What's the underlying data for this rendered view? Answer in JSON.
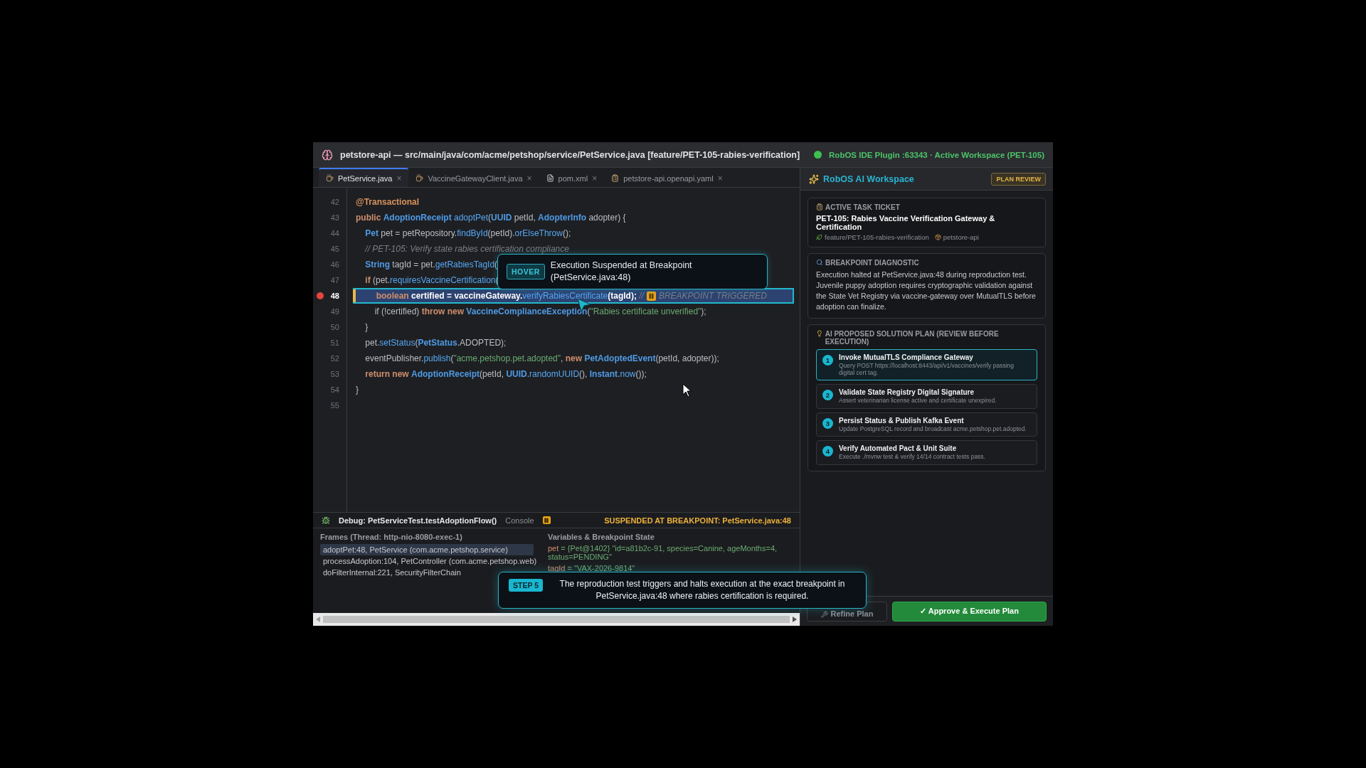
{
  "window": {
    "title": "petstore-api — src/main/java/com/acme/petshop/service/PetService.java [feature/PET-105-rabies-verification]",
    "status": "RobOS IDE Plugin :63343 · Active Workspace (PET-105)"
  },
  "tabs": [
    {
      "label": "PetService.java",
      "kind": "java",
      "selected": true,
      "close": "×"
    },
    {
      "label": "VaccineGatewayClient.java",
      "kind": "java",
      "selected": false,
      "close": "×"
    },
    {
      "label": "pom.xml",
      "kind": "xml",
      "selected": false,
      "close": "×"
    },
    {
      "label": "petstore-api.openapi.yaml",
      "kind": "yaml",
      "selected": false,
      "close": "×"
    }
  ],
  "code": [
    {
      "num": "42",
      "breakpoint": false,
      "current": false,
      "tokens": [
        {
          "kind": "ann",
          "t": "@Transactional"
        }
      ]
    },
    {
      "num": "43",
      "breakpoint": false,
      "current": false,
      "tokens": [
        {
          "kind": "kw",
          "t": "public "
        },
        {
          "kind": "type",
          "t": "AdoptionReceipt "
        },
        {
          "kind": "method",
          "t": "adoptPet"
        },
        {
          "kind": "plain",
          "t": "("
        },
        {
          "kind": "type",
          "t": "UUID"
        },
        {
          "kind": "plain",
          "t": " petId, "
        },
        {
          "kind": "type",
          "t": "AdopterInfo"
        },
        {
          "kind": "plain",
          "t": " adopter) {"
        }
      ]
    },
    {
      "num": "44",
      "breakpoint": false,
      "current": false,
      "tokens": [
        {
          "kind": "type",
          "t": "    Pet"
        },
        {
          "kind": "plain",
          "t": " pet = petRepository."
        },
        {
          "kind": "method",
          "t": "findById"
        },
        {
          "kind": "plain",
          "t": "(petId)."
        },
        {
          "kind": "method",
          "t": "orElseThrow"
        },
        {
          "kind": "plain",
          "t": "();"
        }
      ]
    },
    {
      "num": "45",
      "breakpoint": false,
      "current": false,
      "tokens": [
        {
          "kind": "comment",
          "t": "    // PET-105: Verify state rabies certification compliance"
        }
      ]
    },
    {
      "num": "46",
      "breakpoint": false,
      "current": false,
      "tokens": [
        {
          "kind": "type",
          "t": "    String"
        },
        {
          "kind": "plain",
          "t": " tagId = pet."
        },
        {
          "kind": "method",
          "t": "getRabiesTagId"
        },
        {
          "kind": "plain",
          "t": "("
        }
      ]
    },
    {
      "num": "47",
      "breakpoint": false,
      "current": false,
      "tokens": [
        {
          "kind": "kw",
          "t": "    if"
        },
        {
          "kind": "plain",
          "t": " (pet."
        },
        {
          "kind": "method",
          "t": "requiresVaccineCertification"
        },
        {
          "kind": "plain",
          "t": "("
        }
      ]
    },
    {
      "num": "48",
      "breakpoint": true,
      "current": true,
      "tokens": [
        {
          "kind": "kw",
          "t": "        boolean"
        },
        {
          "kind": "bold",
          "t": " certified = vaccineGateway."
        },
        {
          "kind": "method",
          "t": "verifyRabiesCertificate"
        },
        {
          "kind": "bold",
          "t": "(tagId);"
        },
        {
          "kind": "comment",
          "t": " //"
        },
        {
          "kind": "pause"
        },
        {
          "kind": "comment",
          "t": "BREAKPOINT TRIGGERED"
        }
      ]
    },
    {
      "num": "49",
      "breakpoint": false,
      "current": false,
      "tokens": [
        {
          "kind": "plain",
          "t": "        if (!certified) "
        },
        {
          "kind": "kw",
          "t": "throw new "
        },
        {
          "kind": "type",
          "t": "VaccineComplianceException"
        },
        {
          "kind": "plain",
          "t": "("
        },
        {
          "kind": "string",
          "t": "\"Rabies certificate unverified\""
        },
        {
          "kind": "plain",
          "t": ");"
        }
      ]
    },
    {
      "num": "50",
      "breakpoint": false,
      "current": false,
      "tokens": [
        {
          "kind": "plain",
          "t": "    }"
        }
      ]
    },
    {
      "num": "51",
      "breakpoint": false,
      "current": false,
      "tokens": [
        {
          "kind": "plain",
          "t": "    pet."
        },
        {
          "kind": "method",
          "t": "setStatus"
        },
        {
          "kind": "plain",
          "t": "("
        },
        {
          "kind": "type",
          "t": "PetStatus"
        },
        {
          "kind": "plain",
          "t": ".ADOPTED);"
        }
      ]
    },
    {
      "num": "52",
      "breakpoint": false,
      "current": false,
      "tokens": [
        {
          "kind": "plain",
          "t": "    eventPublisher."
        },
        {
          "kind": "method",
          "t": "publish"
        },
        {
          "kind": "plain",
          "t": "("
        },
        {
          "kind": "string",
          "t": "\"acme.petshop.pet.adopted\""
        },
        {
          "kind": "plain",
          "t": ", "
        },
        {
          "kind": "kw",
          "t": "new "
        },
        {
          "kind": "type",
          "t": "PetAdoptedEvent"
        },
        {
          "kind": "plain",
          "t": "(petId, adopter));"
        }
      ]
    },
    {
      "num": "53",
      "breakpoint": false,
      "current": false,
      "tokens": [
        {
          "kind": "kw",
          "t": "    return new "
        },
        {
          "kind": "type",
          "t": "AdoptionReceipt"
        },
        {
          "kind": "plain",
          "t": "(petId, "
        },
        {
          "kind": "type",
          "t": "UUID"
        },
        {
          "kind": "plain",
          "t": "."
        },
        {
          "kind": "method",
          "t": "randomUUID"
        },
        {
          "kind": "plain",
          "t": "(), "
        },
        {
          "kind": "type",
          "t": "Instant"
        },
        {
          "kind": "plain",
          "t": "."
        },
        {
          "kind": "method",
          "t": "now"
        },
        {
          "kind": "plain",
          "t": "());"
        }
      ]
    },
    {
      "num": "54",
      "breakpoint": false,
      "current": false,
      "tokens": [
        {
          "kind": "plain",
          "t": "}"
        }
      ]
    },
    {
      "num": "55",
      "breakpoint": false,
      "current": false
    }
  ],
  "hover": {
    "badge": "HOVER",
    "text": "Execution Suspended at Breakpoint (PetService.java:48)"
  },
  "debug": {
    "title": "Debug: PetServiceTest.testAdoptionFlow()",
    "console": "Console",
    "status": "SUSPENDED AT BREAKPOINT: PetService.java:48",
    "frames_title": "Frames (Thread: http-nio-8080-exec-1)",
    "frames": [
      {
        "label": "adoptPet:48, PetService (com.acme.petshop.service)",
        "selected": true
      },
      {
        "label": "processAdoption:104, PetController (com.acme.petshop.web)",
        "selected": false
      },
      {
        "label": "doFilterInternal:221, SecurityFilterChain",
        "selected": false
      }
    ],
    "vars_title": "Variables & Breakpoint State",
    "variables": [
      {
        "name": "pet",
        "operator": "=",
        "value": "{Pet@1402} \"id=a81b2c-91, species=Canine, ageMonths=4, status=PENDING\""
      },
      {
        "name": "tagId",
        "operator": "=",
        "value": "\"VAX-2026-9814\""
      }
    ]
  },
  "step": {
    "badge": "STEP 5",
    "text": "The reproduction test triggers and halts execution at the exact breakpoint in PetService.java:48 where rabies certification is required."
  },
  "panel": {
    "title": "RobOS AI Workspace",
    "badge": "PLAN REVIEW",
    "ticket": {
      "heading": "ACTIVE TASK TICKET",
      "title": "PET-105: Rabies Vaccine Verification Gateway & Certification",
      "branch": "feature/PET-105-rabies-verification",
      "project": "petstore-api"
    },
    "diagnostic": {
      "heading": "BREAKPOINT DIAGNOSTIC",
      "text": "Execution halted at PetService.java:48 during reproduction test. Juvenile puppy adoption requires cryptographic validation against the State Vet Registry via vaccine-gateway over MutualTLS before adoption can finalize."
    },
    "plan": {
      "heading": "AI PROPOSED SOLUTION PLAN (REVIEW BEFORE EXECUTION)",
      "steps": [
        {
          "num": "1",
          "title": "Invoke MutualTLS Compliance Gateway",
          "text": "Query POST https://localhost:8443/api/v1/vaccines/verify passing digital cert tag.",
          "selected": true
        },
        {
          "num": "2",
          "title": "Validate State Registry Digital Signature",
          "text": "Assert veterinarian license active and certificate unexpired.",
          "selected": false
        },
        {
          "num": "3",
          "title": "Persist Status & Publish Kafka Event",
          "text": "Update PostgreSQL record and broadcast acme.petshop.pet.adopted.",
          "selected": false
        },
        {
          "num": "4",
          "title": "Verify Automated Pact & Unit Suite",
          "text": "Execute ./mvnw test & verify 14/14 contract tests pass.",
          "selected": false
        }
      ]
    },
    "refine": "Refine Plan",
    "approve": "✓ Approve & Execute Plan"
  }
}
